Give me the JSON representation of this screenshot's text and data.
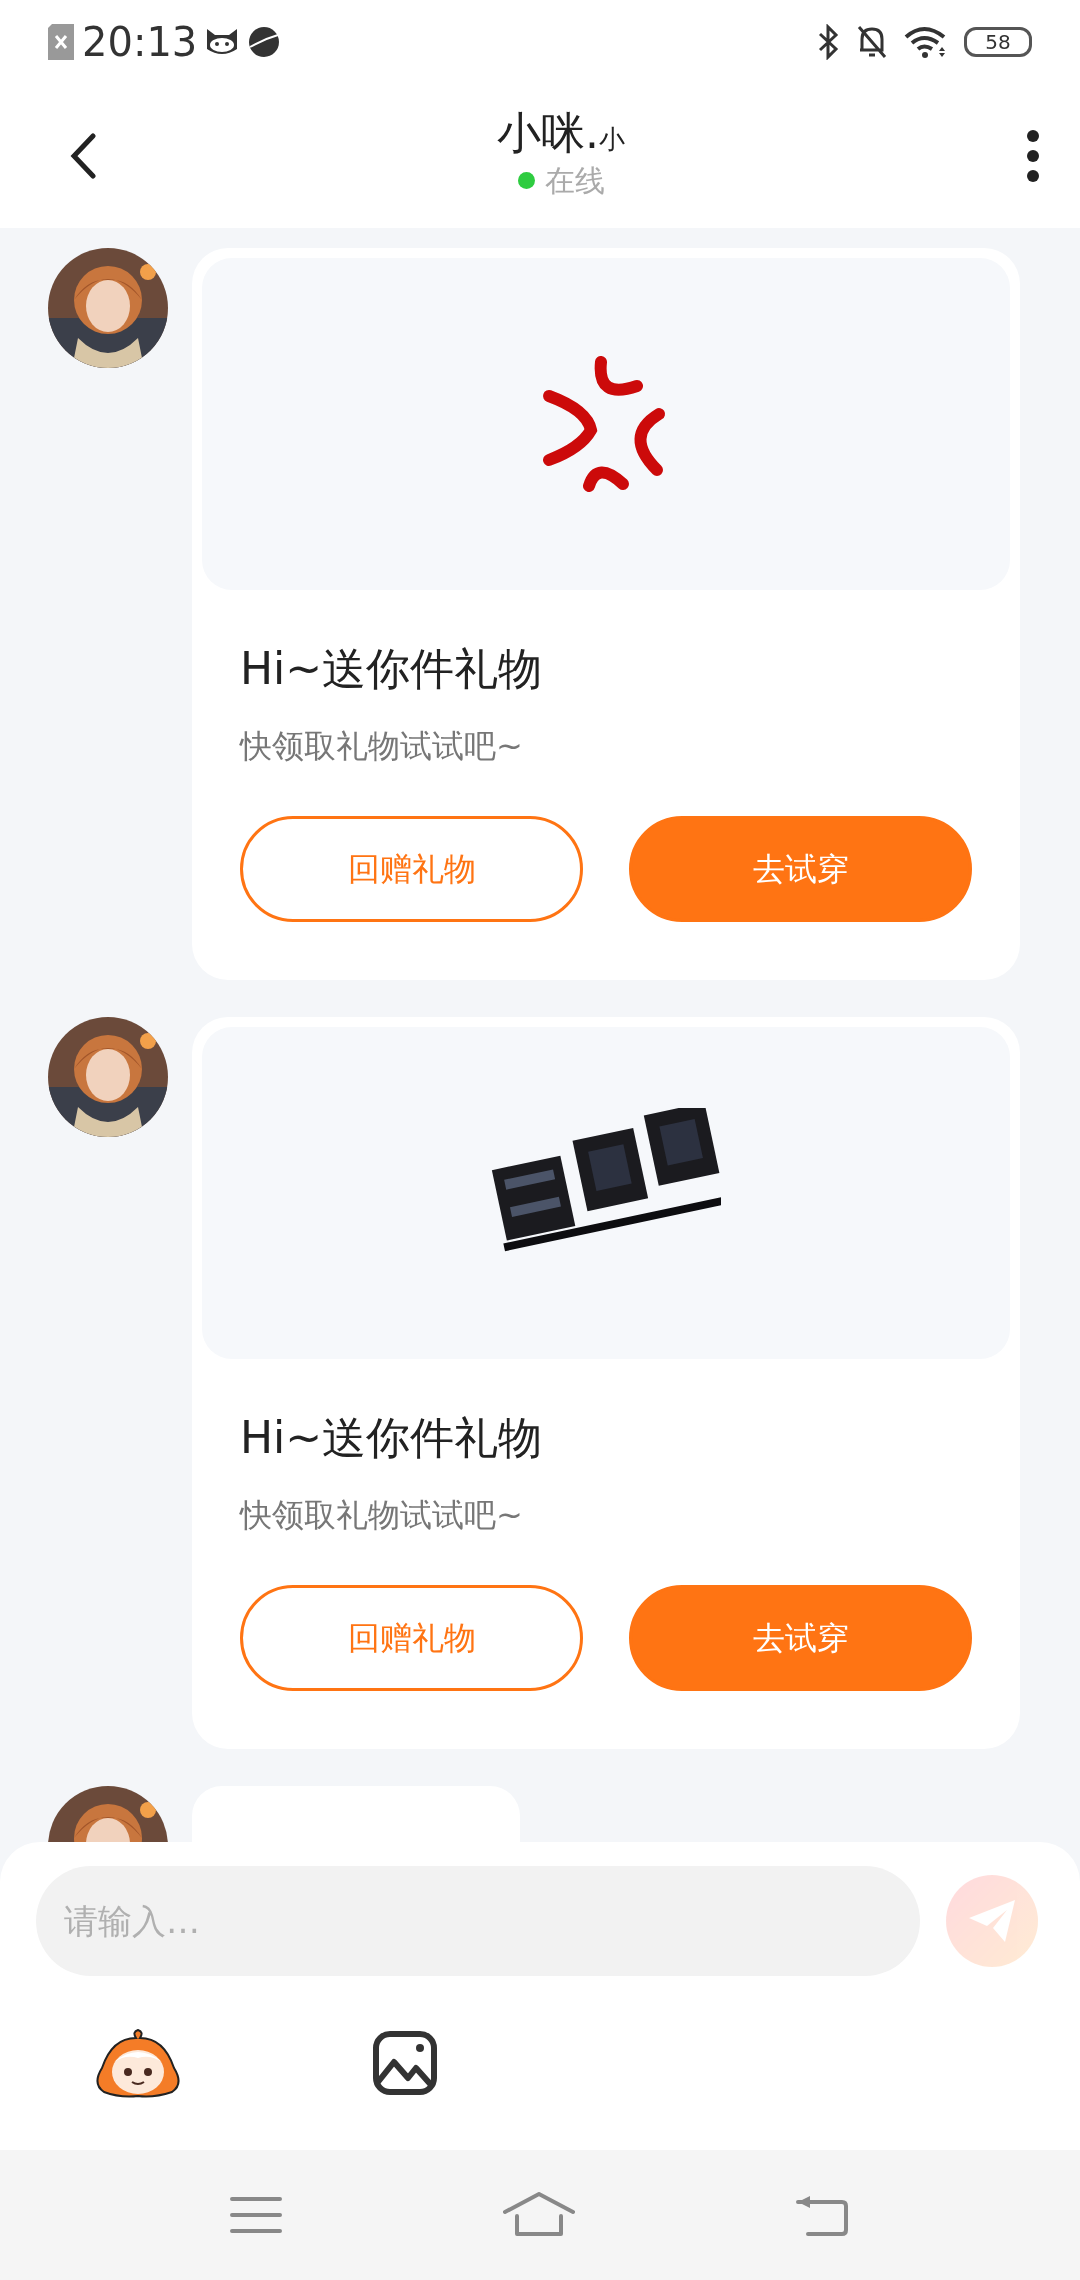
{
  "status_bar": {
    "time": "20:13",
    "battery": "58"
  },
  "header": {
    "title": "小咪.$_{小}$",
    "status": "在线",
    "online": true
  },
  "messages": [
    {
      "kind": "gift",
      "sticker": {
        "kind": "icon"
      },
      "title": "Hi~送你件礼物",
      "subtitle": "快领取礼物试试吧~",
      "buttons": [
        {
          "label": "回赠礼物",
          "kind": "outline"
        },
        {
          "label": "去试穿",
          "kind": "solid"
        }
      ]
    },
    {
      "kind": "gift",
      "sticker": {
        "kind": "picture"
      },
      "title": "Hi~送你件礼物",
      "subtitle": "快领取礼物试试吧~",
      "buttons": [
        {
          "label": "回赠礼物",
          "kind": "outline"
        },
        {
          "label": "去试穿",
          "kind": "solid"
        }
      ]
    },
    {
      "kind": "text"
    }
  ],
  "composer": {
    "placeholder": "请输入…",
    "send_disabled": true
  }
}
